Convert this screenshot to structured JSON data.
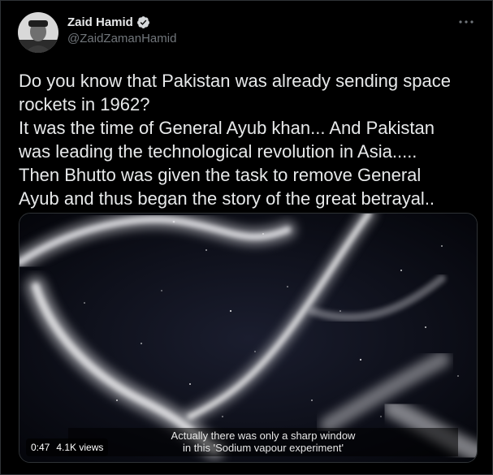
{
  "author": {
    "display_name": "Zaid Hamid",
    "handle": "@ZaidZamanHamid",
    "verified": true
  },
  "tweet": {
    "lines": [
      "Do you know that Pakistan was already sending space",
      "rockets in 1962?",
      "It was the time of General Ayub khan... And Pakistan",
      "was leading the technological revolution in Asia.....",
      "Then Bhutto was given the task to remove General",
      "Ayub and thus began the story of the great betrayal.."
    ]
  },
  "video": {
    "caption_line1": "Actually there was only a sharp window",
    "caption_line2": "in this 'Sodium vapour experiment'",
    "timestamp": "0:47",
    "views": "4.1K views"
  },
  "icons": {
    "more": "more-horizontal-icon",
    "verified": "verified-badge-icon"
  },
  "colors": {
    "background": "#000000",
    "text": "#e7e9ea",
    "secondary_text": "#71767b",
    "border": "#2f3336"
  }
}
